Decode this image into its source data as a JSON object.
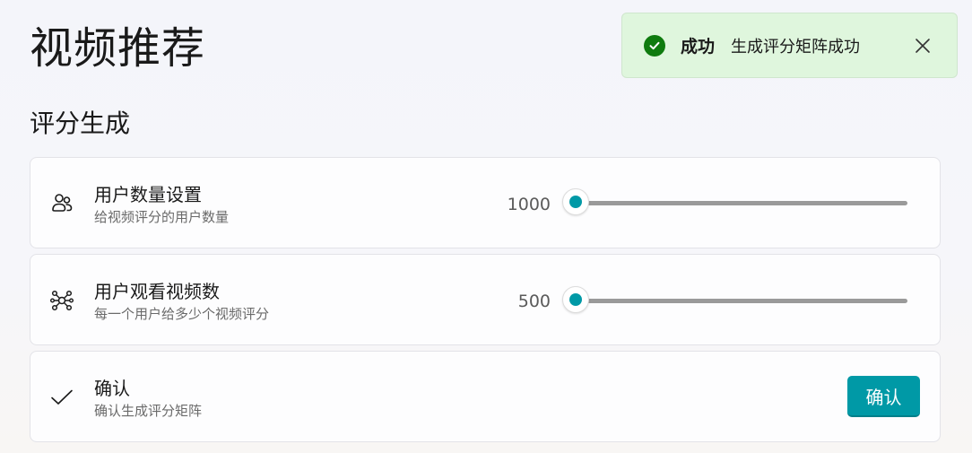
{
  "page": {
    "title": "视频推荐",
    "section_title": "评分生成"
  },
  "toast": {
    "title": "成功",
    "message": "生成评分矩阵成功",
    "status_color": "#0f7b0f",
    "background_color": "#dff6dd"
  },
  "settings": [
    {
      "label": "用户数量设置",
      "description": "给视频评分的用户数量",
      "value": "1000",
      "icon": "people-icon",
      "slider_fraction": 0.0
    },
    {
      "label": "用户观看视频数",
      "description": "每一个用户给多少个视频评分",
      "value": "500",
      "icon": "network-icon",
      "slider_fraction": 0.0
    }
  ],
  "confirm": {
    "label": "确认",
    "description": "确认生成评分矩阵",
    "button_label": "确认",
    "icon": "checkmark-icon"
  },
  "colors": {
    "accent": "#0099a6",
    "track": "#9a9a9a"
  }
}
